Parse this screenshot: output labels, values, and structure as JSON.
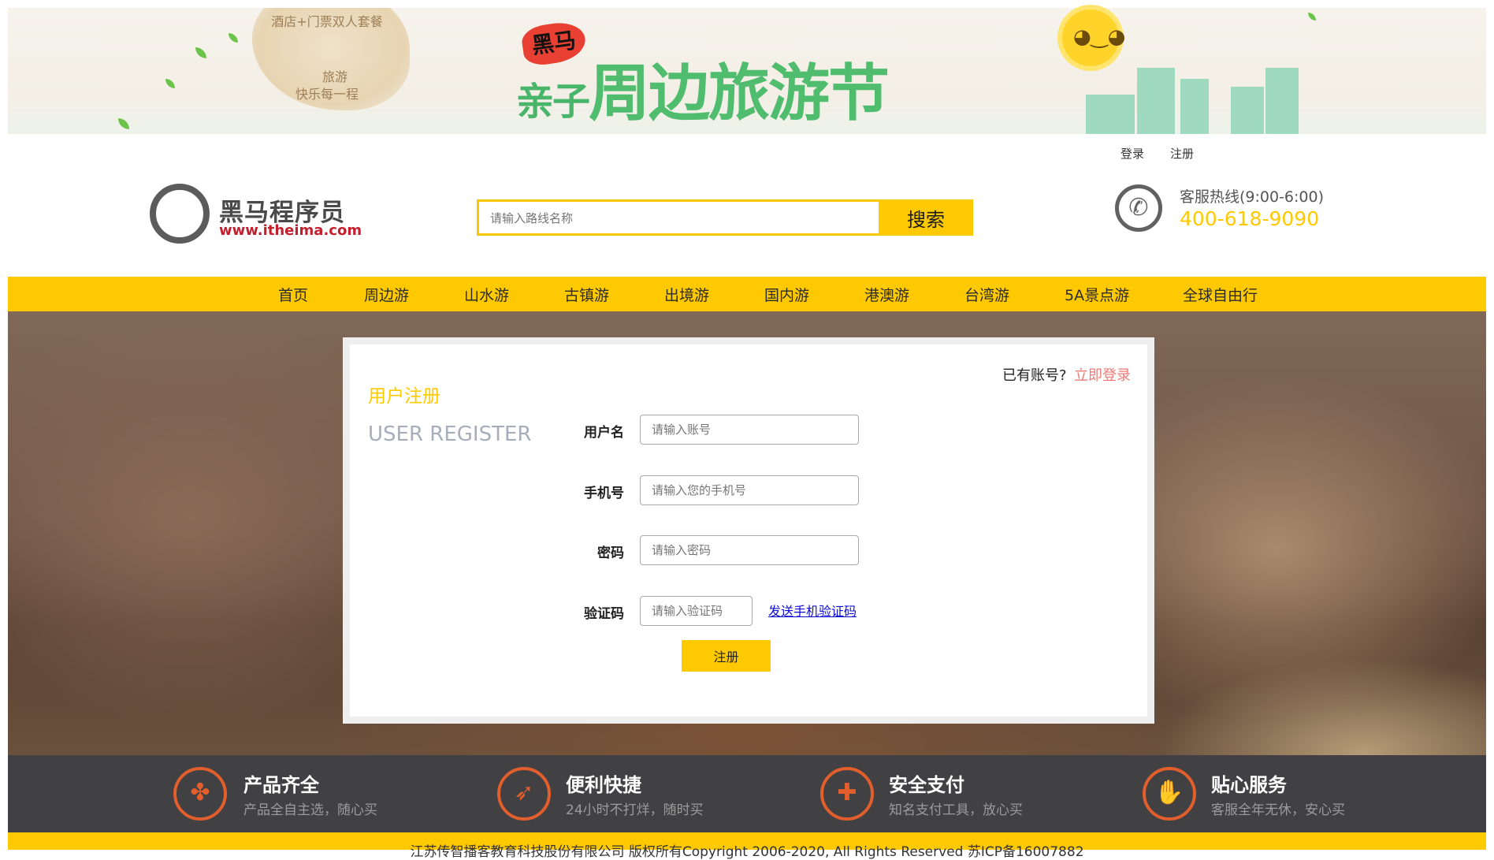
{
  "banner": {
    "card_line1": "酒店+门票双人套餐",
    "card_line2": "旅游",
    "card_line3": "快乐每一程",
    "badge": "黑马",
    "title_prefix": "亲子",
    "title": "周边旅游节"
  },
  "toplinks": {
    "login": "登录",
    "register": "注册"
  },
  "logo": {
    "title": "黑马程序员",
    "subtitle": "www.itheima.com"
  },
  "search": {
    "placeholder": "请输入路线名称",
    "button_label": "搜索"
  },
  "hotline": {
    "label": "客服热线(9:00-6:00)",
    "number": "400-618-9090"
  },
  "nav": {
    "items": [
      "首页",
      "周边游",
      "山水游",
      "古镇游",
      "出境游",
      "国内游",
      "港澳游",
      "台湾游",
      "5A景点游",
      "全球自由行"
    ]
  },
  "register_panel": {
    "title_cn": "用户注册",
    "title_en": "USER REGISTER",
    "have_account": "已有账号?",
    "login_now": "立即登录",
    "fields": [
      {
        "label": "用户名",
        "placeholder": "请输入账号"
      },
      {
        "label": "手机号",
        "placeholder": "请输入您的手机号"
      },
      {
        "label": "密码",
        "placeholder": "请输入密码"
      },
      {
        "label": "验证码",
        "placeholder": "请输入验证码"
      }
    ],
    "send_code": "发送手机验证码",
    "submit": "注册"
  },
  "features": [
    {
      "icon": "clover-icon",
      "title": "产品齐全",
      "desc": "产品全自主选，随心买"
    },
    {
      "icon": "rocket-icon",
      "title": "便利快捷",
      "desc": "24小时不打烊，随时买"
    },
    {
      "icon": "shield-icon",
      "title": "安全支付",
      "desc": "知名支付工具，放心买"
    },
    {
      "icon": "thumbs-up-icon",
      "title": "贴心服务",
      "desc": "客服全年无休，安心买"
    }
  ],
  "footer": {
    "text": "江苏传智播客教育科技股份有限公司 版权所有Copyright 2006-2020, All Rights Reserved 苏ICP备16007882"
  },
  "colors": {
    "accent": "#ffc900",
    "link_red": "#ee7a75",
    "feature_orange": "#e25e2c",
    "dark_band": "#414143"
  }
}
